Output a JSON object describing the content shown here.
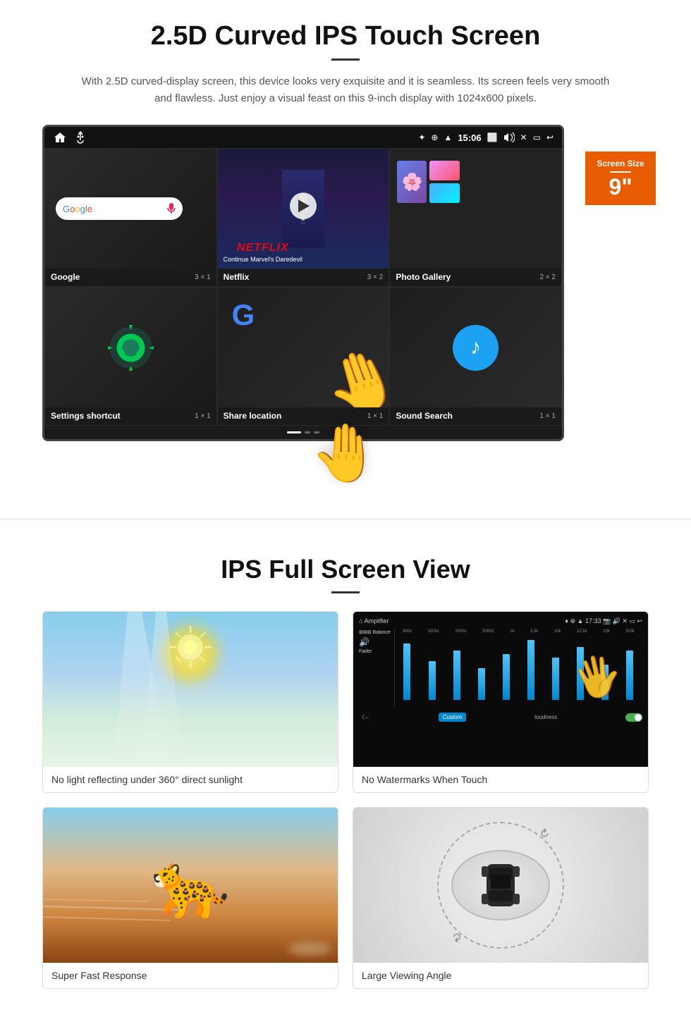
{
  "section1": {
    "title": "2.5D Curved IPS Touch Screen",
    "description": "With 2.5D curved-display screen, this device looks very exquisite and it is seamless. Its screen feels very smooth and flawless. Just enjoy a visual feast on this 9-inch display with 1024x600 pixels.",
    "screen_badge": {
      "label": "Screen Size",
      "size": "9\""
    },
    "status_bar": {
      "time": "15:06",
      "icons": [
        "bluetooth",
        "location",
        "wifi",
        "camera",
        "volume",
        "close",
        "window",
        "back"
      ]
    },
    "apps": [
      {
        "name": "Google",
        "size": "3 × 1"
      },
      {
        "name": "Netflix",
        "size": "3 × 2"
      },
      {
        "name": "Photo Gallery",
        "size": "2 × 2"
      },
      {
        "name": "Settings shortcut",
        "size": "1 × 1"
      },
      {
        "name": "Share location",
        "size": "1 × 1"
      },
      {
        "name": "Sound Search",
        "size": "1 × 1"
      }
    ],
    "netflix": {
      "logo": "NETFLIX",
      "subtitle": "Continue Marvel's Daredevil"
    }
  },
  "section2": {
    "title": "IPS Full Screen View",
    "features": [
      {
        "id": "sunlight",
        "caption": "No light reflecting under 360° direct sunlight"
      },
      {
        "id": "amplifier",
        "caption": "No Watermarks When Touch"
      },
      {
        "id": "cheetah",
        "caption": "Super Fast Response"
      },
      {
        "id": "car",
        "caption": "Large Viewing Angle"
      }
    ]
  }
}
